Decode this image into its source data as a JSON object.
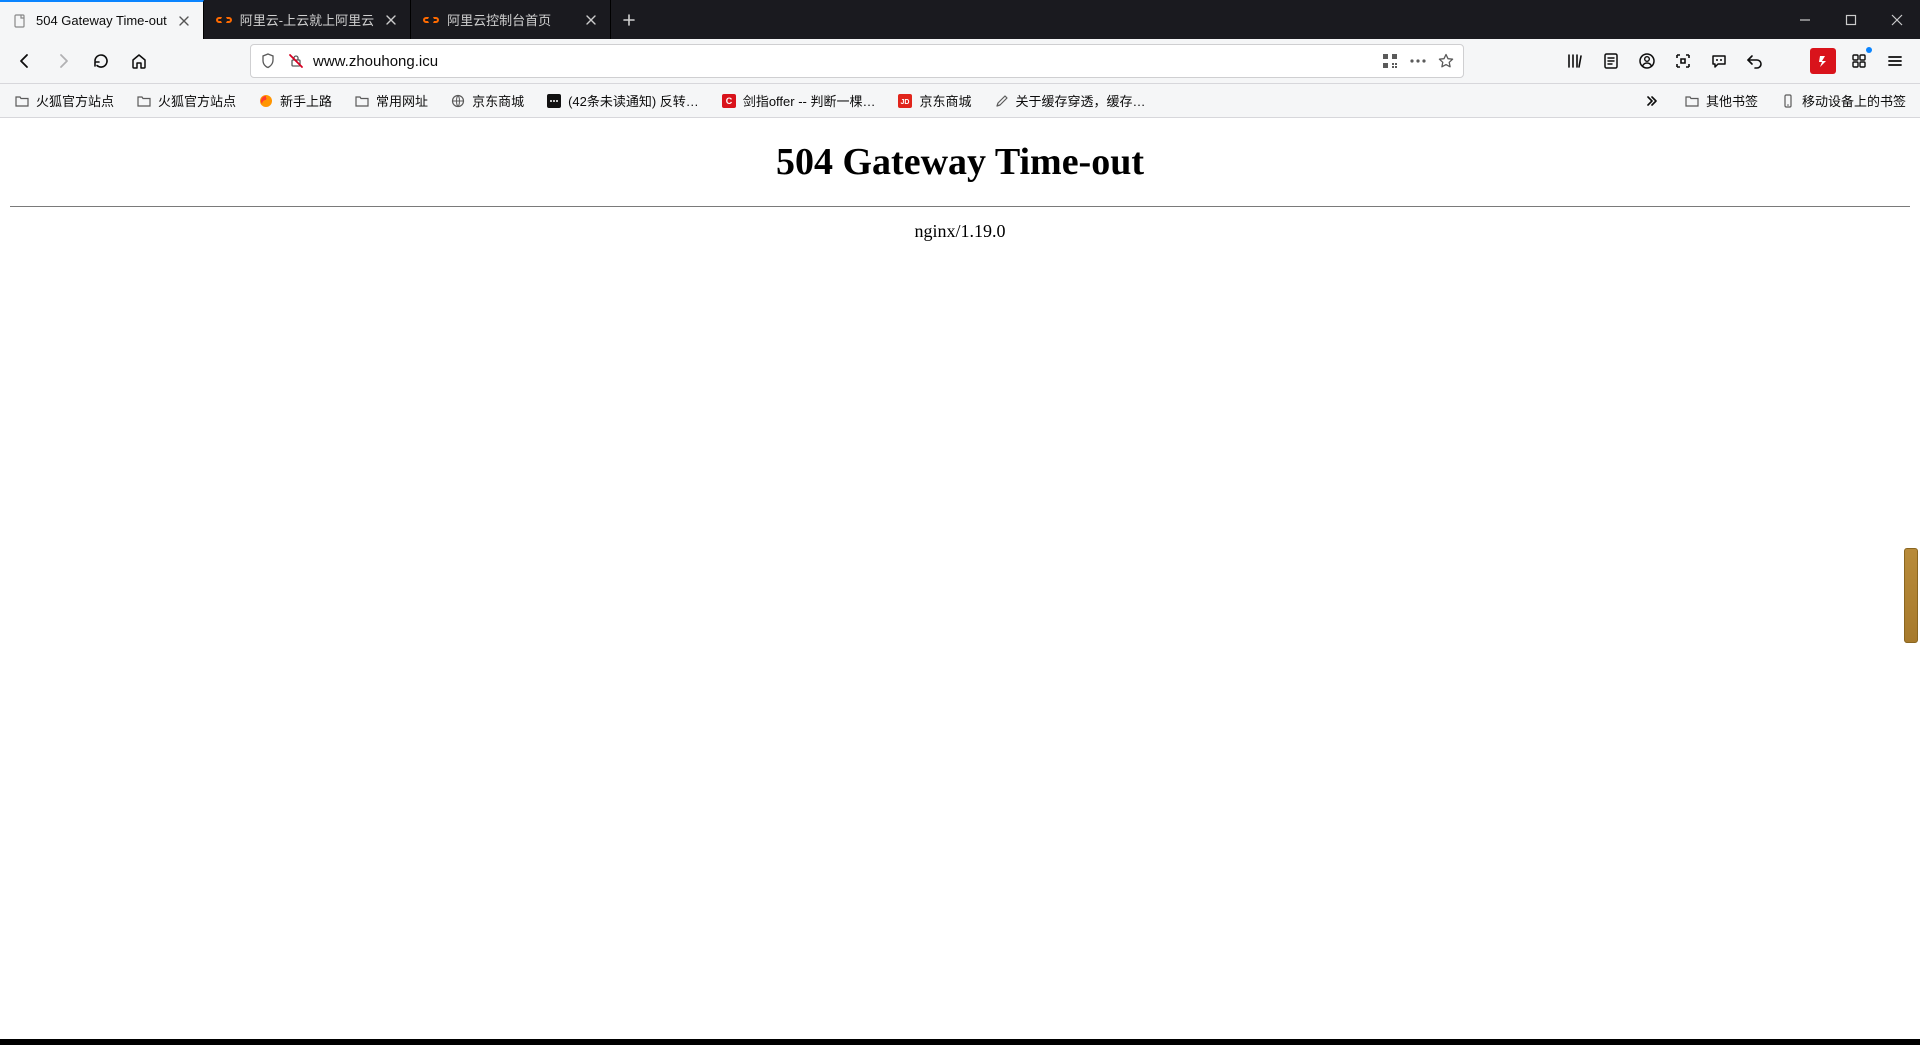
{
  "tabs": [
    {
      "label": "504 Gateway Time-out",
      "favicon": "blank-doc",
      "active": true
    },
    {
      "label": "阿里云-上云就上阿里云",
      "favicon": "aliyun",
      "active": false
    },
    {
      "label": "阿里云控制台首页",
      "favicon": "aliyun",
      "active": false
    }
  ],
  "address_bar": {
    "url_display": "www.zhouhong.icu",
    "url_highlight_start": "www.",
    "url_highlight_host": "zhouhong",
    "url_highlight_end": ".icu"
  },
  "bookmarks": [
    {
      "label": "火狐官方站点",
      "icon": "folder"
    },
    {
      "label": "火狐官方站点",
      "icon": "folder"
    },
    {
      "label": "新手上路",
      "icon": "firefox"
    },
    {
      "label": "常用网址",
      "icon": "folder"
    },
    {
      "label": "京东商城",
      "icon": "globe"
    },
    {
      "label": "(42条未读通知) 反转…",
      "icon": "square-dark"
    },
    {
      "label": "剑指offer -- 判断一棵…",
      "icon": "c-red"
    },
    {
      "label": "京东商城",
      "icon": "jd-red"
    },
    {
      "label": "关于缓存穿透，缓存…",
      "icon": "pen"
    }
  ],
  "bookmarks_right": [
    {
      "label": "其他书签",
      "icon": "folder"
    },
    {
      "label": "移动设备上的书签",
      "icon": "mobile"
    }
  ],
  "page": {
    "heading": "504 Gateway Time-out",
    "server_line": "nginx/1.19.0"
  }
}
